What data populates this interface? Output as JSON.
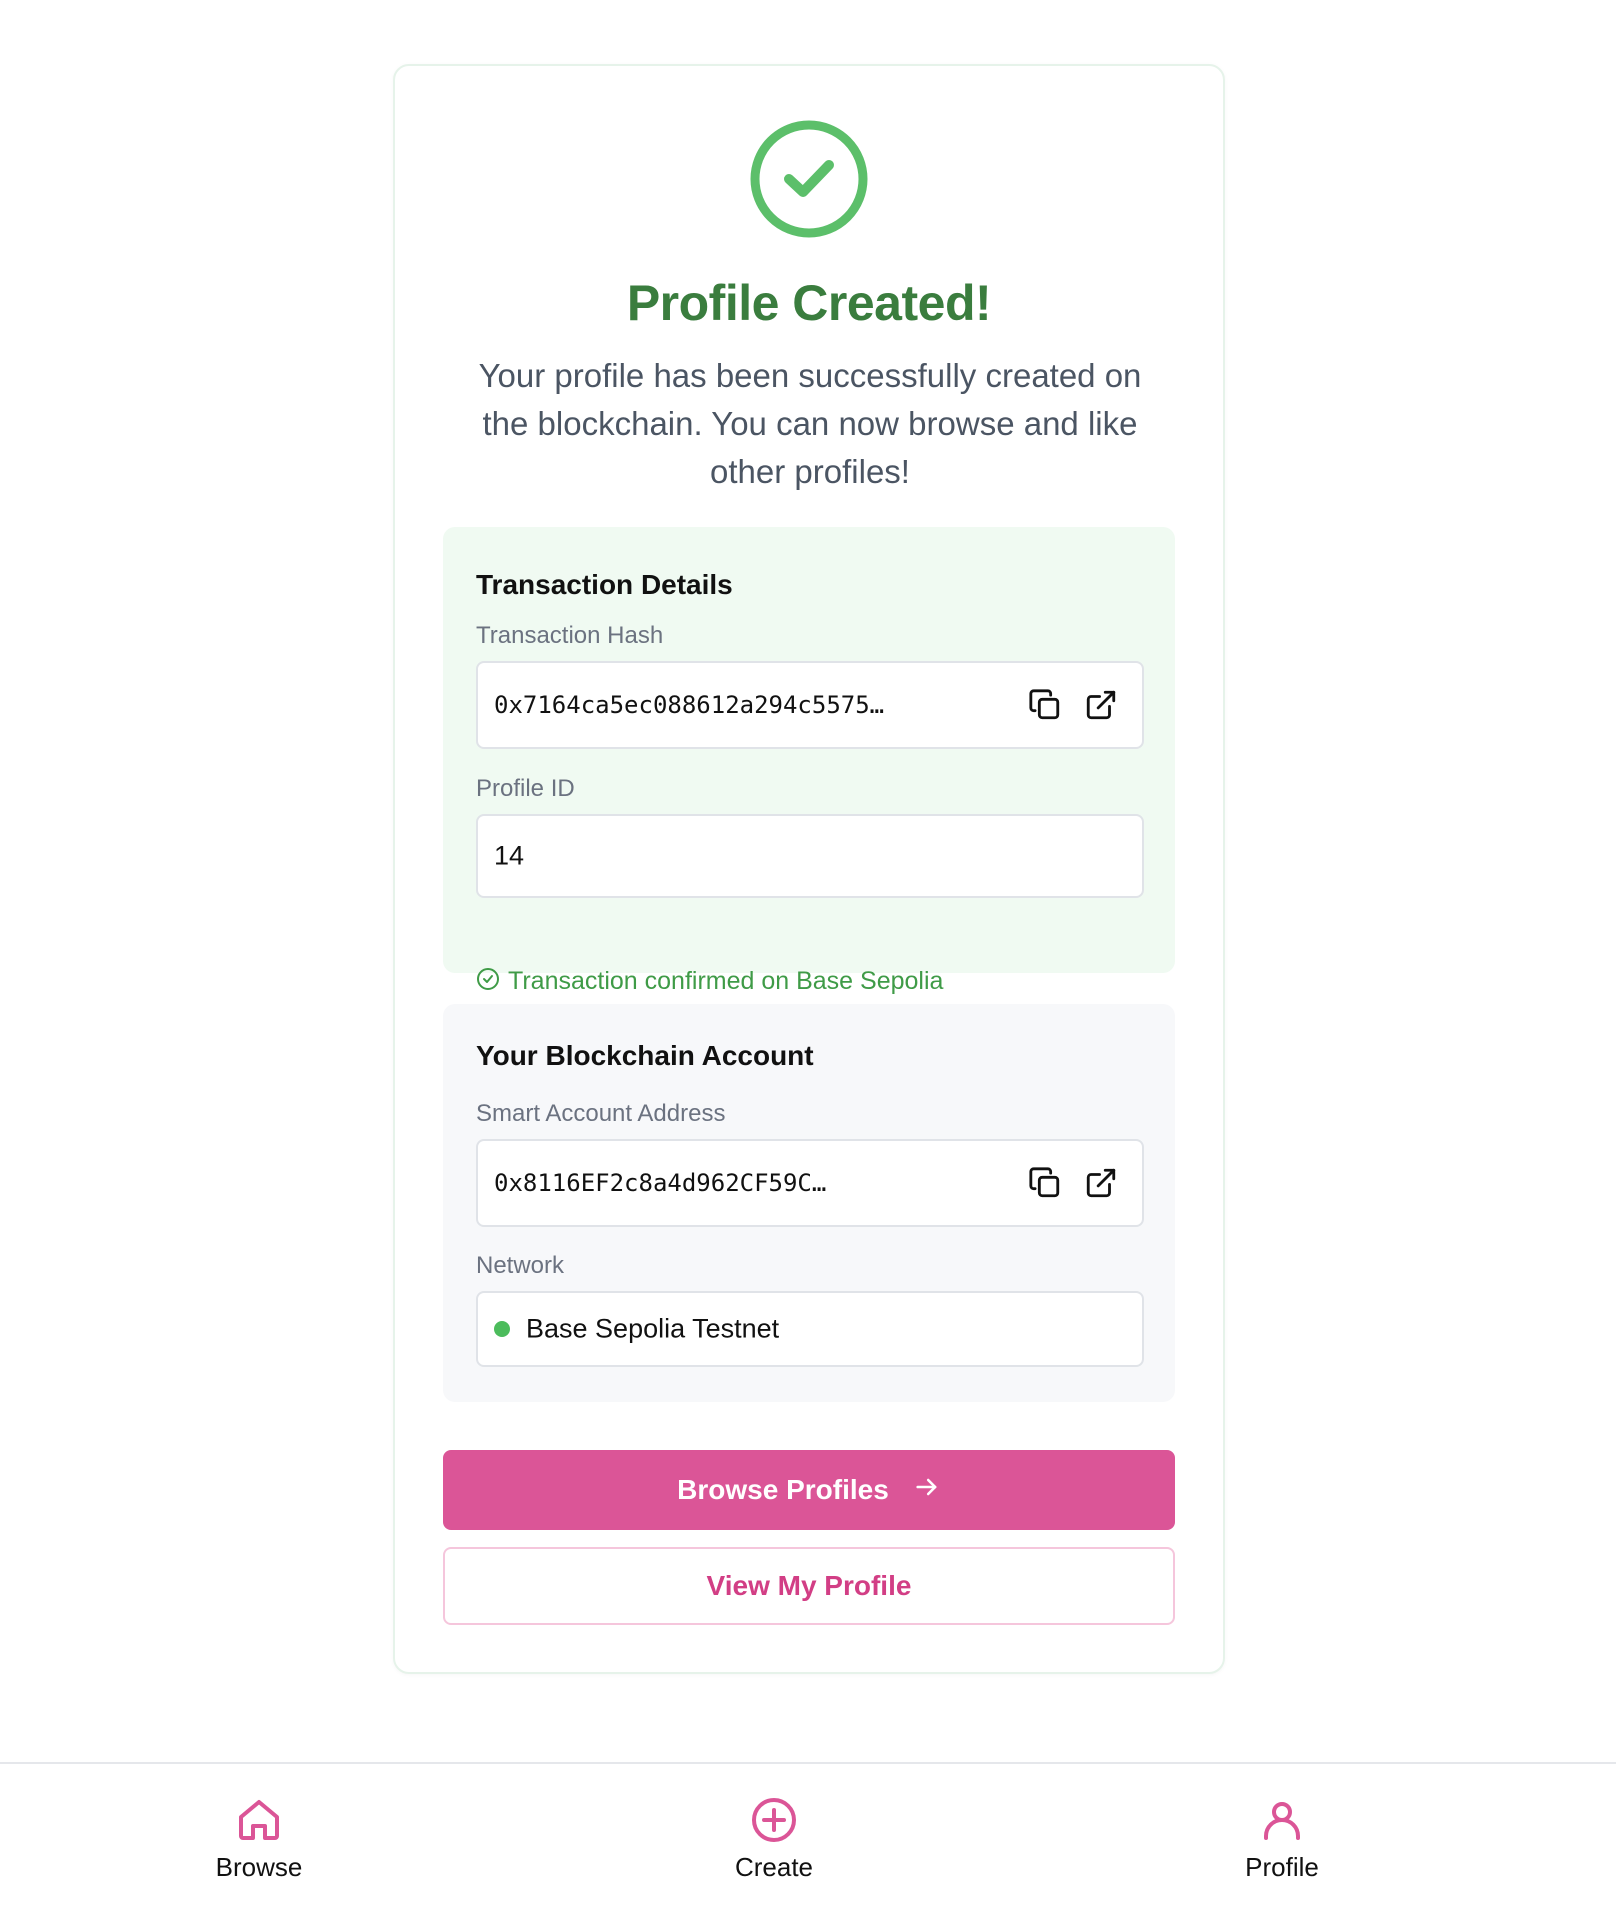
{
  "success": {
    "title": "Profile Created!",
    "message": "Your profile has been successfully created on the blockchain. You can now browse and like other profiles!"
  },
  "transaction": {
    "heading": "Transaction Details",
    "hash_label": "Transaction Hash",
    "hash_value": "0x7164ca5ec088612a294c5575…",
    "profile_id_label": "Profile ID",
    "profile_id_value": "14",
    "confirm_text": "Transaction confirmed on Base Sepolia"
  },
  "account": {
    "heading": "Your Blockchain Account",
    "address_label": "Smart Account Address",
    "address_value": "0x8116EF2c8a4d962CF59C…",
    "network_label": "Network",
    "network_value": "Base Sepolia Testnet"
  },
  "actions": {
    "browse_label": "Browse Profiles",
    "view_profile_label": "View My Profile"
  },
  "nav": {
    "items": [
      {
        "label": "Browse",
        "icon": "home-icon"
      },
      {
        "label": "Create",
        "icon": "plus-circle-icon"
      },
      {
        "label": "Profile",
        "icon": "user-icon"
      }
    ]
  },
  "colors": {
    "success_green": "#3a7d3e",
    "check_green": "#5cbf6a",
    "accent_pink": "#db5597",
    "network_dot": "#4cbc5c"
  }
}
